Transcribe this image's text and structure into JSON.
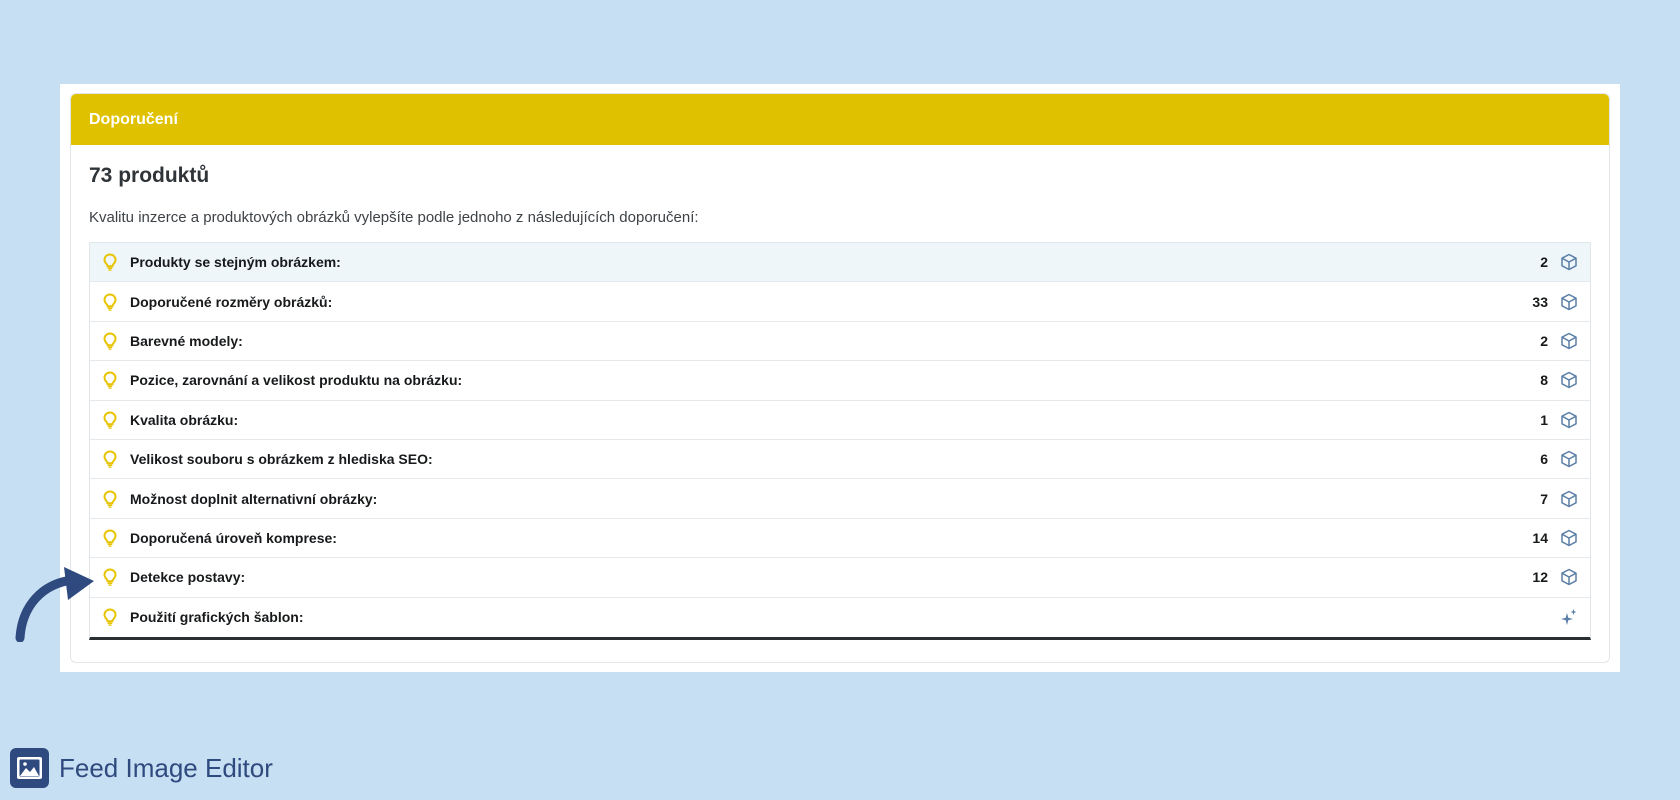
{
  "card": {
    "header_title": "Doporučení",
    "count_title": "73 produktů",
    "intro": "Kvalitu inzerce a produktových obrázků vylepšíte podle jednoho z následujících doporučení:"
  },
  "recommendations": [
    {
      "label": "Produkty se stejným obrázkem:",
      "count": "2",
      "icon": "cube-icon"
    },
    {
      "label": "Doporučené rozměry obrázků:",
      "count": "33",
      "icon": "cube-icon"
    },
    {
      "label": "Barevné modely:",
      "count": "2",
      "icon": "cube-icon"
    },
    {
      "label": "Pozice, zarovnání a velikost produktu na obrázku:",
      "count": "8",
      "icon": "cube-icon"
    },
    {
      "label": "Kvalita obrázku:",
      "count": "1",
      "icon": "cube-icon"
    },
    {
      "label": "Velikost souboru s obrázkem z hlediska SEO:",
      "count": "6",
      "icon": "cube-icon"
    },
    {
      "label": "Možnost doplnit alternativní obrázky:",
      "count": "7",
      "icon": "cube-icon"
    },
    {
      "label": "Doporučená úroveň komprese:",
      "count": "14",
      "icon": "cube-icon"
    },
    {
      "label": "Detekce postavy:",
      "count": "12",
      "icon": "cube-icon"
    },
    {
      "label": "Použití grafických šablon:",
      "count": "",
      "icon": "sparkle-icon"
    }
  ],
  "brand": {
    "name": "Feed Image Editor"
  },
  "colors": {
    "background": "#c7dff2",
    "header": "#dfc100",
    "bulb": "#e8c400",
    "icon": "#5b7fa6",
    "brand": "#2f4a7f"
  }
}
